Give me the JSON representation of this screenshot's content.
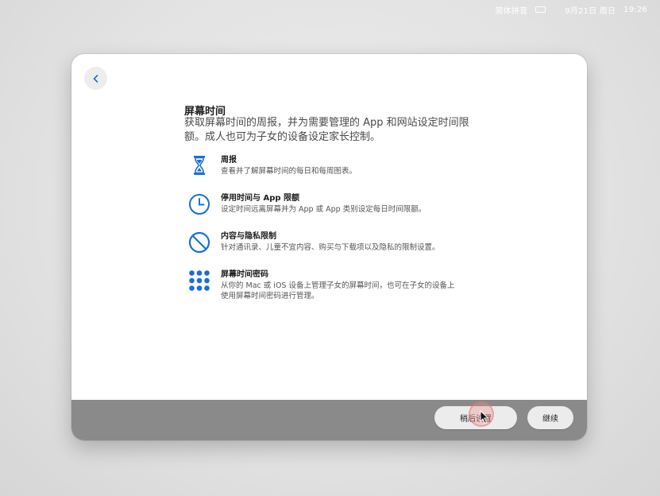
{
  "menubar": {
    "input_method": "简体拼音",
    "date": "9月21日 周日",
    "time": "19:26"
  },
  "screen": {
    "title": "屏幕时间",
    "subtitle": "获取屏幕时间的周报，并为需要管理的 App 和网站设定时间限额。成人也可为子女的设备设定家长控制。"
  },
  "features": [
    {
      "icon": "hourglass-icon",
      "title": "周报",
      "description": "查看并了解屏幕时间的每日和每周图表。"
    },
    {
      "icon": "clock-icon",
      "title": "停用时间与 App 限额",
      "description": "设定时间远离屏幕并为 App 或 App 类别设定每日时间限额。"
    },
    {
      "icon": "restriction-icon",
      "title": "内容与隐私限制",
      "description": "针对通讯录、儿童不宜内容、购买与下载项以及隐私的限制设置。"
    },
    {
      "icon": "keypad-icon",
      "title": "屏幕时间密码",
      "description": "从你的 Mac 或 iOS 设备上管理子女的屏幕时间，也可在子女的设备上\n使用屏幕时间密码进行管理。"
    }
  ],
  "footer": {
    "later_label": "稍后设置",
    "continue_label": "继续"
  },
  "colors": {
    "accent": "#1a6fd4",
    "footer_bg": "#8a8a8a"
  }
}
